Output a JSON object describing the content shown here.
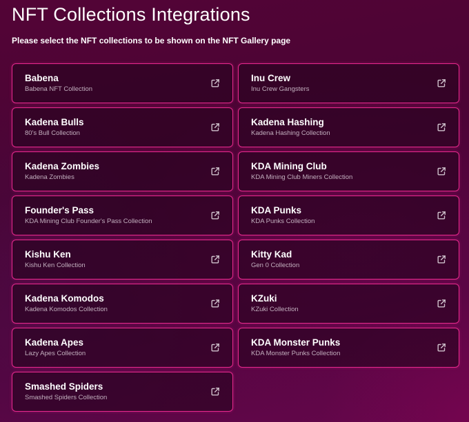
{
  "page": {
    "title": "NFT Collections Integrations",
    "subtitle": "Please select the NFT collections to be shown on the NFT Gallery page"
  },
  "colors": {
    "accent": "#e8288e",
    "card_bg": "#26041e",
    "text": "#ffffff",
    "muted_text": "#c3b0bf"
  },
  "collections": [
    {
      "name": "Babena",
      "description": "Babena NFT Collection",
      "icon": "external-link-icon"
    },
    {
      "name": "Inu Crew",
      "description": "Inu Crew Gangsters",
      "icon": "external-link-icon"
    },
    {
      "name": "Kadena Bulls",
      "description": "80's Bull Collection",
      "icon": "external-link-icon"
    },
    {
      "name": "Kadena Hashing",
      "description": "Kadena Hashing Collection",
      "icon": "external-link-icon"
    },
    {
      "name": "Kadena Zombies",
      "description": "Kadena Zombies",
      "icon": "external-link-icon"
    },
    {
      "name": "KDA Mining Club",
      "description": "KDA Mining Club Miners Collection",
      "icon": "external-link-icon"
    },
    {
      "name": "Founder's Pass",
      "description": "KDA Mining Club Founder's Pass Collection",
      "icon": "external-link-icon"
    },
    {
      "name": "KDA Punks",
      "description": "KDA Punks Collection",
      "icon": "external-link-icon"
    },
    {
      "name": "Kishu Ken",
      "description": "Kishu Ken Collection",
      "icon": "external-link-icon"
    },
    {
      "name": "Kitty Kad",
      "description": "Gen 0 Collection",
      "icon": "external-link-icon"
    },
    {
      "name": "Kadena Komodos",
      "description": "Kadena Komodos Collection",
      "icon": "external-link-icon"
    },
    {
      "name": "KZuki",
      "description": "KZuki Collection",
      "icon": "external-link-icon"
    },
    {
      "name": "Kadena Apes",
      "description": "Lazy Apes Collection",
      "icon": "external-link-icon"
    },
    {
      "name": "KDA Monster Punks",
      "description": "KDA Monster Punks Collection",
      "icon": "external-link-icon"
    },
    {
      "name": "Smashed Spiders",
      "description": "Smashed Spiders Collection",
      "icon": "external-link-icon"
    }
  ]
}
